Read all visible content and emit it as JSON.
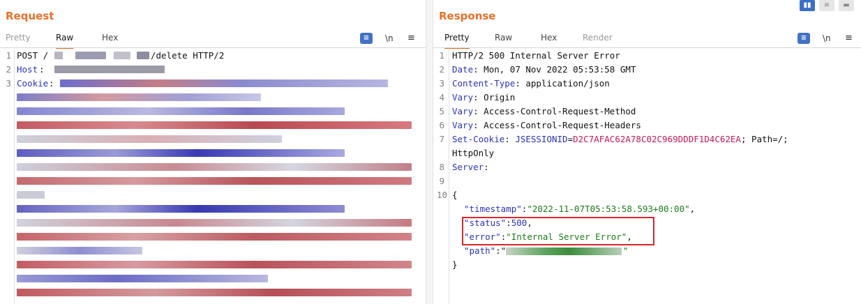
{
  "request": {
    "title": "Request",
    "tabs": [
      "Pretty",
      "Raw",
      "Hex"
    ],
    "active_tab": "Raw",
    "lines": [
      {
        "num": "1",
        "text": "POST /",
        "tail": "/delete HTTP/2"
      },
      {
        "num": "2",
        "key": "Host",
        "sep": ": "
      },
      {
        "num": "3",
        "key": "Cookie",
        "sep": ": "
      }
    ]
  },
  "response": {
    "title": "Response",
    "tabs": [
      "Pretty",
      "Raw",
      "Hex",
      "Render"
    ],
    "active_tab": "Pretty",
    "view_toggle": [
      "split-horizontal-icon",
      "split-vertical-icon",
      "single-pane-icon"
    ],
    "lines": [
      {
        "num": "1",
        "text": "HTTP/2 500 Internal Server Error"
      },
      {
        "num": "2",
        "key": "Date",
        "val": "Mon, 07 Nov 2022 05:53:58 GMT"
      },
      {
        "num": "3",
        "key": "Content-Type",
        "val": "application/json"
      },
      {
        "num": "4",
        "key": "Vary",
        "val": "Origin"
      },
      {
        "num": "5",
        "key": "Vary",
        "val": "Access-Control-Request-Method"
      },
      {
        "num": "6",
        "key": "Vary",
        "val": "Access-Control-Request-Headers"
      },
      {
        "num": "7",
        "key": "Set-Cookie",
        "cookie_name": "JSESSIONID",
        "cookie_val": "D2C7AFAC62A78C02C969DDDF1D4C62EA",
        "cookie_rest": "; Path=/;"
      },
      {
        "num": "",
        "text": "HttpOnly"
      },
      {
        "num": "8",
        "key": "Server",
        "val": ""
      },
      {
        "num": "9",
        "text": ""
      },
      {
        "num": "10",
        "text": "{"
      }
    ],
    "json": {
      "timestamp_key": "\"timestamp\"",
      "timestamp_val": "\"2022-11-07T05:53:58.593+00:00\"",
      "status_key": "\"status\"",
      "status_val": "500",
      "error_key": "\"error\"",
      "error_val": "\"Internal Server Error\"",
      "path_key": "\"path\"",
      "close": "}"
    }
  },
  "toolbar": {
    "newline_label": "\\n",
    "format_icon": "format-icon",
    "menu_icon": "menu-icon"
  },
  "colors": {
    "accent": "#e8702a",
    "key": "#2a33b8",
    "string": "#1a7a18",
    "cookie_value": "#c2185b",
    "highlight": "#d8262c"
  }
}
